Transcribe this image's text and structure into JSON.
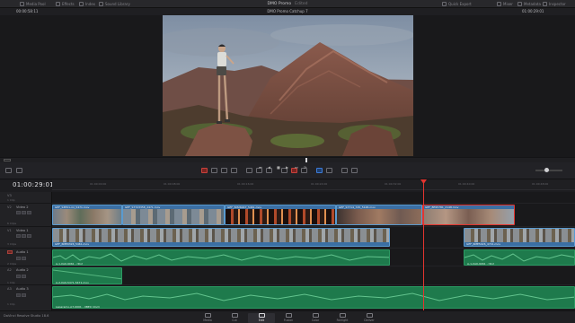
{
  "app": {
    "title": "DMO Promo",
    "title_sub": "Edited",
    "brand": "DaVinci Resolve Studio 18.6"
  },
  "topbar_left": [
    {
      "label": "Media Pool",
      "icon": "media-pool-icon"
    },
    {
      "label": "Effects",
      "icon": "effects-icon"
    },
    {
      "label": "Index",
      "icon": "index-icon"
    },
    {
      "label": "Sound Library",
      "icon": "sound-library-icon"
    }
  ],
  "topbar_right": [
    {
      "label": "Quick Export",
      "icon": "export-icon"
    },
    {
      "label": "Mixer",
      "icon": "mixer-icon"
    },
    {
      "label": "Metadata",
      "icon": "metadata-icon"
    },
    {
      "label": "Inspector",
      "icon": "inspector-icon"
    }
  ],
  "viewer": {
    "left_timecode": "00:00:58:11",
    "title": "DMO Promo Catchup 7",
    "right_timecode": "01:00:29:01"
  },
  "timeline": {
    "timecode": "01:00:29:01",
    "ruler": [
      "01:00:00:00",
      "01:00:08:00",
      "01:00:16:00",
      "01:00:24:00",
      "01:00:32:00",
      "01:00:40:00",
      "01:00:48:00"
    ],
    "playhead_time": "01:00:29:01"
  },
  "tracks": {
    "v3": {
      "id": "V3",
      "count": "1 Clip"
    },
    "v2": {
      "id": "V2",
      "name": "Video 2",
      "count": "6 Clips"
    },
    "v1": {
      "id": "V1",
      "name": "Video 1",
      "count": "3 Clips"
    },
    "a1": {
      "id": "A1",
      "name": "Audio 1",
      "count": "2 Clips"
    },
    "a2": {
      "id": "A2",
      "name": "Audio 2",
      "count": "1 Clip"
    },
    "a3": {
      "id": "A3",
      "name": "Audio 3",
      "count": "1 Clip"
    }
  },
  "clips": {
    "v2": [
      {
        "label": "GEF_S3E01-ml_5471.mov"
      },
      {
        "label": "GEF_S7723358_2471.mov"
      },
      {
        "label": "GEF_5M26047_5461.mov"
      },
      {
        "label": "GEF_S7714_745_5148.mov"
      },
      {
        "label": "GEF_8E95781_2148.mov"
      }
    ],
    "v1": [
      {
        "label": "GEF_6ME0326_5461.mov"
      },
      {
        "label": "GEF_6ME5426_4741.mov"
      }
    ],
    "a1": [
      {
        "label": "A-1-XA0-9061 - [Dx]"
      },
      {
        "label": "A-1-XA0-9061 - [Dx]"
      }
    ],
    "a2": [
      {
        "label": "A-2-XA0-5471-5471.mov"
      }
    ],
    "a3": [
      {
        "label": "Laparamo-A7-0001 - XBE0 (dnd)"
      }
    ]
  },
  "pages": [
    {
      "label": "Media",
      "icon": "media-page-icon"
    },
    {
      "label": "Cut",
      "icon": "cut-page-icon"
    },
    {
      "label": "Edit",
      "icon": "edit-page-icon",
      "active": true
    },
    {
      "label": "Fusion",
      "icon": "fusion-page-icon"
    },
    {
      "label": "Color",
      "icon": "color-page-icon"
    },
    {
      "label": "Fairlight",
      "icon": "fairlight-page-icon"
    },
    {
      "label": "Deliver",
      "icon": "deliver-page-icon"
    }
  ],
  "colors": {
    "playhead": "#e3342f",
    "video_clip": "#3b6fa3",
    "audio_clip": "#1e7a4c",
    "selected_clip": "#e3342f"
  }
}
